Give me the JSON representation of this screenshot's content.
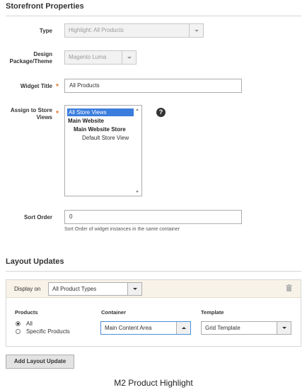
{
  "storefront": {
    "title": "Storefront Properties",
    "type_label": "Type",
    "type_value": "Highlight: All Products",
    "design_label": "Design Package/Theme",
    "design_value": "Magento Luma",
    "widget_title_label": "Widget Title",
    "widget_title_value": "All Products",
    "store_views_label": "Assign to Store Views",
    "store_views": [
      "All Store Views",
      "Main Website",
      "Main Website Store",
      "Default Store View"
    ],
    "store_views_selected": "All Store Views",
    "help_icon": "question-mark",
    "sort_order_label": "Sort Order",
    "sort_order_value": "0",
    "sort_order_note": "Sort Order of widget instances in the same container"
  },
  "layout": {
    "title": "Layout Updates",
    "display_on_label": "Display on",
    "display_on_value": "All Product Types",
    "products_label": "Products",
    "radio_all": "All",
    "radio_specific": "Specific Products",
    "radio_selected": "All",
    "container_label": "Container",
    "container_value": "Main Content Area",
    "template_label": "Template",
    "template_value": "Grid Template",
    "delete_icon": "trash-icon",
    "add_button": "Add Layout Update"
  },
  "caption": "M2 Product Highlight",
  "colors": {
    "required": "#e3742a",
    "selection": "#3b7ddd",
    "layout_header": "#f8f3e8"
  }
}
